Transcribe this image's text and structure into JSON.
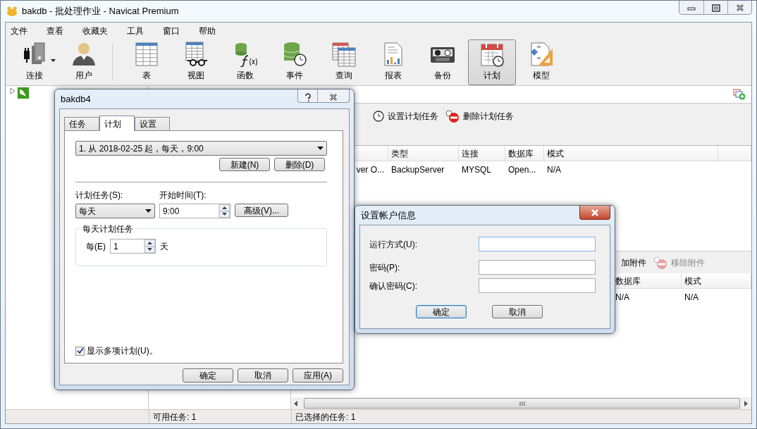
{
  "window": {
    "title": "bakdb - 批处理作业 - Navicat Premium"
  },
  "menu": [
    "文件",
    "查看",
    "收藏夹",
    "工具",
    "窗口",
    "帮助"
  ],
  "toolbar": [
    {
      "label": "连接",
      "kind": "connection",
      "selected": false
    },
    {
      "label": "用户",
      "kind": "user",
      "selected": false
    },
    {
      "label": "表",
      "kind": "table",
      "selected": false
    },
    {
      "label": "视图",
      "kind": "view",
      "selected": false
    },
    {
      "label": "函数",
      "kind": "function",
      "selected": false
    },
    {
      "label": "事件",
      "kind": "event",
      "selected": false
    },
    {
      "label": "查询",
      "kind": "query",
      "selected": false
    },
    {
      "label": "报表",
      "kind": "report",
      "selected": false
    },
    {
      "label": "备份",
      "kind": "backup",
      "selected": false
    },
    {
      "label": "计划",
      "kind": "schedule",
      "selected": true
    },
    {
      "label": "模型",
      "kind": "model",
      "selected": false
    }
  ],
  "job_actions": [
    {
      "label": "设置计划任务",
      "kind": "clock"
    },
    {
      "label": "删除计划任务",
      "kind": "delete"
    }
  ],
  "job_table": {
    "columns": [
      "",
      "类型",
      "连接",
      "数据库",
      "模式"
    ],
    "rows": [
      {
        "cells": [
          "ver O...",
          "BackupServer",
          "MYSQL",
          "Open...",
          "N/A"
        ]
      }
    ]
  },
  "attachment_actions": [
    {
      "label": "加附件",
      "kind": "add",
      "disabled": false
    },
    {
      "label": "移除附件",
      "kind": "delete",
      "disabled": true
    }
  ],
  "attachment_table": {
    "columns": [
      "数据库",
      "模式"
    ],
    "rows": [
      {
        "cells": [
          "N/A",
          "N/A"
        ]
      }
    ]
  },
  "status_bar": [
    "可用任务: 1",
    "已选择的任务: 1"
  ],
  "schedule_dialog": {
    "title": "bakdb4",
    "tabs": [
      {
        "label": "任务",
        "selected": false
      },
      {
        "label": "计划",
        "selected": true
      },
      {
        "label": "设置",
        "selected": false
      }
    ],
    "schedule_select": "1. 从 2018-02-25 起，每天，9:00",
    "list_buttons": [
      "新建(N)",
      "删除(D)"
    ],
    "frequency_label": "计划任务(S):",
    "frequency_value": "每天",
    "start_label": "开始时间(T):",
    "start_value": "9:00",
    "advanced_button": "高级(V)...",
    "group": {
      "title": "每天计划任务",
      "every_label": "每(E)",
      "every_value": "1",
      "unit": "天"
    },
    "multi_schedule": {
      "label": "显示多项计划(U)。",
      "checked": true
    },
    "buttons": [
      "确定",
      "取消",
      "应用(A)"
    ]
  },
  "account_dialog": {
    "title": "设置帐户信息",
    "fields": [
      {
        "label": "运行方式(U):"
      },
      {
        "label": "密码(P):"
      },
      {
        "label": "确认密码(C):"
      }
    ],
    "buttons": [
      "确定",
      "取消"
    ]
  }
}
